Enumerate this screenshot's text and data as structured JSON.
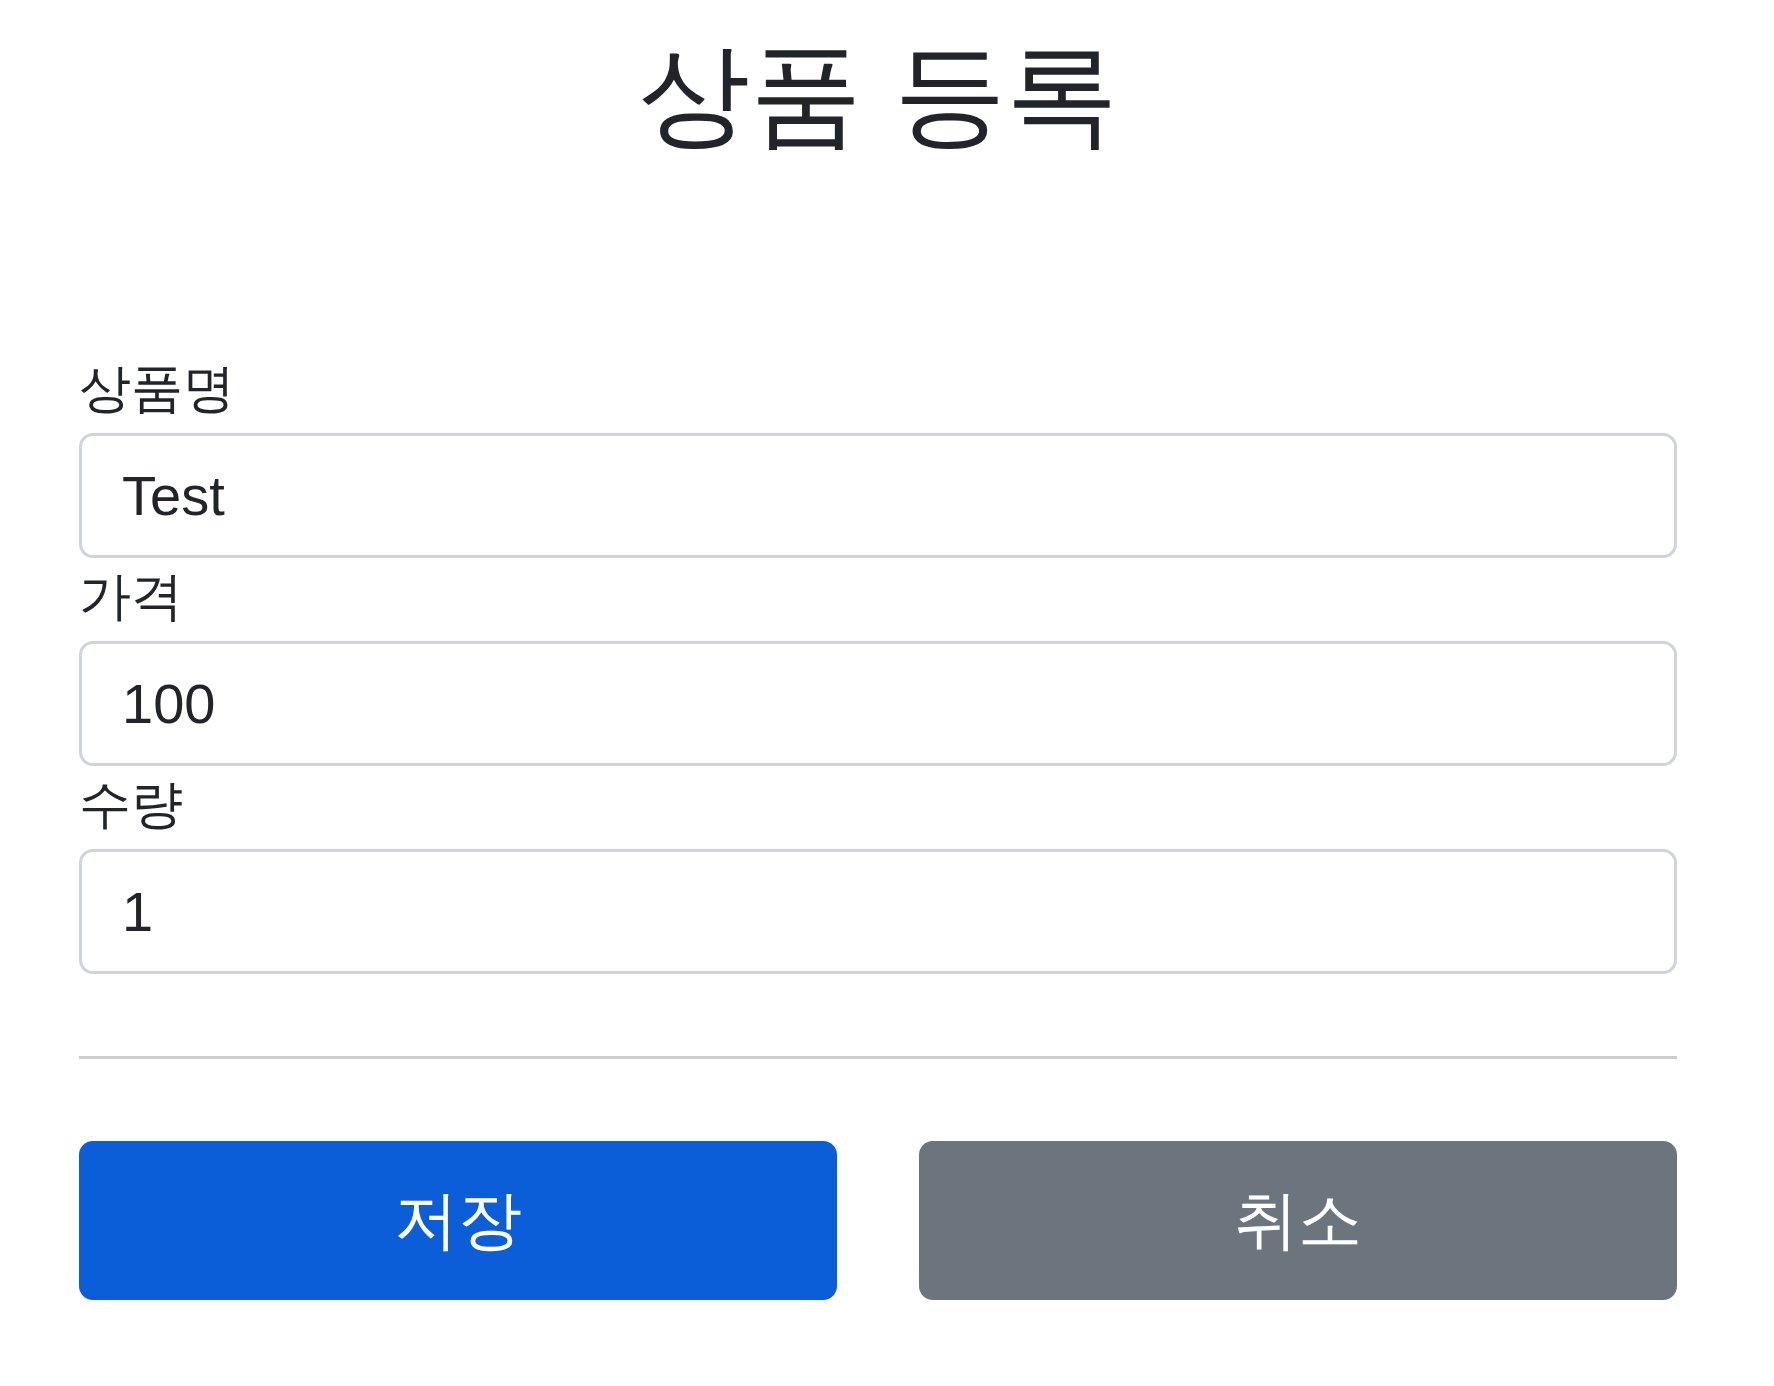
{
  "title": "상품 등록",
  "fields": [
    {
      "label": "상품명",
      "value": "Test"
    },
    {
      "label": "가격",
      "value": "100"
    },
    {
      "label": "수량",
      "value": "1"
    }
  ],
  "buttons": [
    {
      "label": "저장",
      "kind": "primary"
    },
    {
      "label": "취소",
      "kind": "secondary"
    }
  ]
}
